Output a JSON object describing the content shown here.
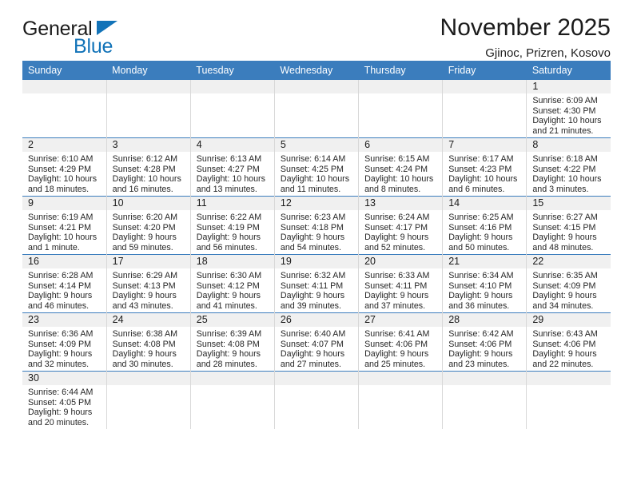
{
  "brand": {
    "name_top": "General",
    "name_bottom": "Blue",
    "triangle_color": "#1273b8"
  },
  "header": {
    "title": "November 2025",
    "subtitle": "Gjinoc, Prizren, Kosovo"
  },
  "theme": {
    "header_blue": "#3b7dbd",
    "daybar_gray": "#f0f0f0",
    "text": "#262626"
  },
  "weekdays": [
    "Sunday",
    "Monday",
    "Tuesday",
    "Wednesday",
    "Thursday",
    "Friday",
    "Saturday"
  ],
  "weeks": [
    [
      {
        "day": "",
        "empty": true
      },
      {
        "day": "",
        "empty": true
      },
      {
        "day": "",
        "empty": true
      },
      {
        "day": "",
        "empty": true
      },
      {
        "day": "",
        "empty": true
      },
      {
        "day": "",
        "empty": true
      },
      {
        "day": "1",
        "sunrise": "Sunrise: 6:09 AM",
        "sunset": "Sunset: 4:30 PM",
        "daylight": "Daylight: 10 hours and 21 minutes."
      }
    ],
    [
      {
        "day": "2",
        "sunrise": "Sunrise: 6:10 AM",
        "sunset": "Sunset: 4:29 PM",
        "daylight": "Daylight: 10 hours and 18 minutes."
      },
      {
        "day": "3",
        "sunrise": "Sunrise: 6:12 AM",
        "sunset": "Sunset: 4:28 PM",
        "daylight": "Daylight: 10 hours and 16 minutes."
      },
      {
        "day": "4",
        "sunrise": "Sunrise: 6:13 AM",
        "sunset": "Sunset: 4:27 PM",
        "daylight": "Daylight: 10 hours and 13 minutes."
      },
      {
        "day": "5",
        "sunrise": "Sunrise: 6:14 AM",
        "sunset": "Sunset: 4:25 PM",
        "daylight": "Daylight: 10 hours and 11 minutes."
      },
      {
        "day": "6",
        "sunrise": "Sunrise: 6:15 AM",
        "sunset": "Sunset: 4:24 PM",
        "daylight": "Daylight: 10 hours and 8 minutes."
      },
      {
        "day": "7",
        "sunrise": "Sunrise: 6:17 AM",
        "sunset": "Sunset: 4:23 PM",
        "daylight": "Daylight: 10 hours and 6 minutes."
      },
      {
        "day": "8",
        "sunrise": "Sunrise: 6:18 AM",
        "sunset": "Sunset: 4:22 PM",
        "daylight": "Daylight: 10 hours and 3 minutes."
      }
    ],
    [
      {
        "day": "9",
        "sunrise": "Sunrise: 6:19 AM",
        "sunset": "Sunset: 4:21 PM",
        "daylight": "Daylight: 10 hours and 1 minute."
      },
      {
        "day": "10",
        "sunrise": "Sunrise: 6:20 AM",
        "sunset": "Sunset: 4:20 PM",
        "daylight": "Daylight: 9 hours and 59 minutes."
      },
      {
        "day": "11",
        "sunrise": "Sunrise: 6:22 AM",
        "sunset": "Sunset: 4:19 PM",
        "daylight": "Daylight: 9 hours and 56 minutes."
      },
      {
        "day": "12",
        "sunrise": "Sunrise: 6:23 AM",
        "sunset": "Sunset: 4:18 PM",
        "daylight": "Daylight: 9 hours and 54 minutes."
      },
      {
        "day": "13",
        "sunrise": "Sunrise: 6:24 AM",
        "sunset": "Sunset: 4:17 PM",
        "daylight": "Daylight: 9 hours and 52 minutes."
      },
      {
        "day": "14",
        "sunrise": "Sunrise: 6:25 AM",
        "sunset": "Sunset: 4:16 PM",
        "daylight": "Daylight: 9 hours and 50 minutes."
      },
      {
        "day": "15",
        "sunrise": "Sunrise: 6:27 AM",
        "sunset": "Sunset: 4:15 PM",
        "daylight": "Daylight: 9 hours and 48 minutes."
      }
    ],
    [
      {
        "day": "16",
        "sunrise": "Sunrise: 6:28 AM",
        "sunset": "Sunset: 4:14 PM",
        "daylight": "Daylight: 9 hours and 46 minutes."
      },
      {
        "day": "17",
        "sunrise": "Sunrise: 6:29 AM",
        "sunset": "Sunset: 4:13 PM",
        "daylight": "Daylight: 9 hours and 43 minutes."
      },
      {
        "day": "18",
        "sunrise": "Sunrise: 6:30 AM",
        "sunset": "Sunset: 4:12 PM",
        "daylight": "Daylight: 9 hours and 41 minutes."
      },
      {
        "day": "19",
        "sunrise": "Sunrise: 6:32 AM",
        "sunset": "Sunset: 4:11 PM",
        "daylight": "Daylight: 9 hours and 39 minutes."
      },
      {
        "day": "20",
        "sunrise": "Sunrise: 6:33 AM",
        "sunset": "Sunset: 4:11 PM",
        "daylight": "Daylight: 9 hours and 37 minutes."
      },
      {
        "day": "21",
        "sunrise": "Sunrise: 6:34 AM",
        "sunset": "Sunset: 4:10 PM",
        "daylight": "Daylight: 9 hours and 36 minutes."
      },
      {
        "day": "22",
        "sunrise": "Sunrise: 6:35 AM",
        "sunset": "Sunset: 4:09 PM",
        "daylight": "Daylight: 9 hours and 34 minutes."
      }
    ],
    [
      {
        "day": "23",
        "sunrise": "Sunrise: 6:36 AM",
        "sunset": "Sunset: 4:09 PM",
        "daylight": "Daylight: 9 hours and 32 minutes."
      },
      {
        "day": "24",
        "sunrise": "Sunrise: 6:38 AM",
        "sunset": "Sunset: 4:08 PM",
        "daylight": "Daylight: 9 hours and 30 minutes."
      },
      {
        "day": "25",
        "sunrise": "Sunrise: 6:39 AM",
        "sunset": "Sunset: 4:08 PM",
        "daylight": "Daylight: 9 hours and 28 minutes."
      },
      {
        "day": "26",
        "sunrise": "Sunrise: 6:40 AM",
        "sunset": "Sunset: 4:07 PM",
        "daylight": "Daylight: 9 hours and 27 minutes."
      },
      {
        "day": "27",
        "sunrise": "Sunrise: 6:41 AM",
        "sunset": "Sunset: 4:06 PM",
        "daylight": "Daylight: 9 hours and 25 minutes."
      },
      {
        "day": "28",
        "sunrise": "Sunrise: 6:42 AM",
        "sunset": "Sunset: 4:06 PM",
        "daylight": "Daylight: 9 hours and 23 minutes."
      },
      {
        "day": "29",
        "sunrise": "Sunrise: 6:43 AM",
        "sunset": "Sunset: 4:06 PM",
        "daylight": "Daylight: 9 hours and 22 minutes."
      }
    ],
    [
      {
        "day": "30",
        "sunrise": "Sunrise: 6:44 AM",
        "sunset": "Sunset: 4:05 PM",
        "daylight": "Daylight: 9 hours and 20 minutes."
      },
      {
        "day": "",
        "empty": true
      },
      {
        "day": "",
        "empty": true
      },
      {
        "day": "",
        "empty": true
      },
      {
        "day": "",
        "empty": true
      },
      {
        "day": "",
        "empty": true
      },
      {
        "day": "",
        "empty": true
      }
    ]
  ]
}
